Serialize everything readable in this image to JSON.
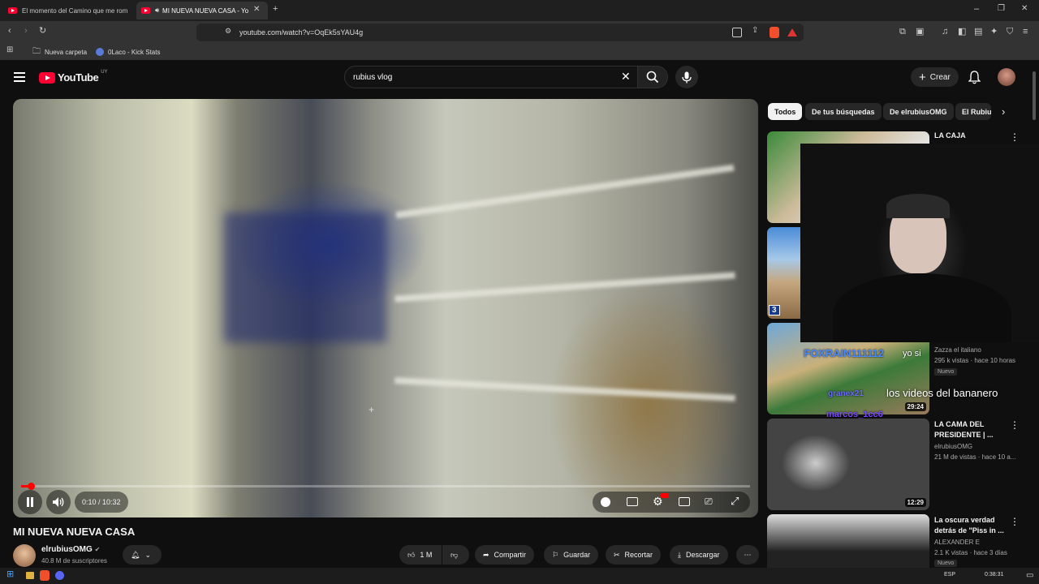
{
  "browser": {
    "tabs": [
      {
        "title": "El momento del Camino que me rom"
      },
      {
        "title": "MI NUEVA NUEVA CASA - Yo"
      }
    ],
    "url": "youtube.com/watch?v=OqEk5sYAU4g",
    "bookmarks": [
      "Nueva carpeta",
      "0Laco - Kick Stats"
    ]
  },
  "header": {
    "logo": "YouTube",
    "region": "UY",
    "search_value": "rubius vlog",
    "create_label": "Crear"
  },
  "player": {
    "time": "0:10 / 10:32",
    "progress_fraction": 0.016
  },
  "video": {
    "title": "MI NUEVA NUEVA CASA",
    "channel": "elrubiusOMG",
    "subscribers": "40.8 M de suscriptores",
    "likes": "1 M",
    "share_label": "Compartir",
    "save_label": "Guardar",
    "clip_label": "Recortar",
    "download_label": "Descargar"
  },
  "chips": [
    "Todos",
    "De tus búsquedas",
    "De elrubiusOMG",
    "El Rubiu"
  ],
  "recommendations": [
    {
      "title": "LA CAJA",
      "meta1": "",
      "meta2": "",
      "duration": "",
      "badge": ""
    },
    {
      "title": "",
      "meta1": "",
      "meta2": "",
      "duration": "",
      "badge": "",
      "thumb_label": "3"
    },
    {
      "title": "",
      "meta1": "Zazza el italiano",
      "meta2": "295 k vistas · hace 10 horas",
      "duration": "29:24",
      "badge": "Nuevo"
    },
    {
      "title": "LA CAMA DEL PRESIDENTE | ...",
      "meta1": "elrubiusOMG",
      "meta2": "21 M de vistas · hace 10 a...",
      "duration": "12:29",
      "badge": ""
    },
    {
      "title": "La oscura verdad detrás de \"Piss in ...",
      "meta1": "ALEXANDER E",
      "meta2": "2.1 K vistas · hace 3 días",
      "duration": "",
      "badge": "Nuevo"
    }
  ],
  "chat_overlay": {
    "line1": "FOXRAIN111112",
    "line1b": "yo si",
    "line2": "los videos del bananero",
    "line3": "granex21",
    "line4": "marcos_1cc6"
  },
  "taskbar": {
    "lang": "ESP",
    "clock": "0:38:31"
  }
}
